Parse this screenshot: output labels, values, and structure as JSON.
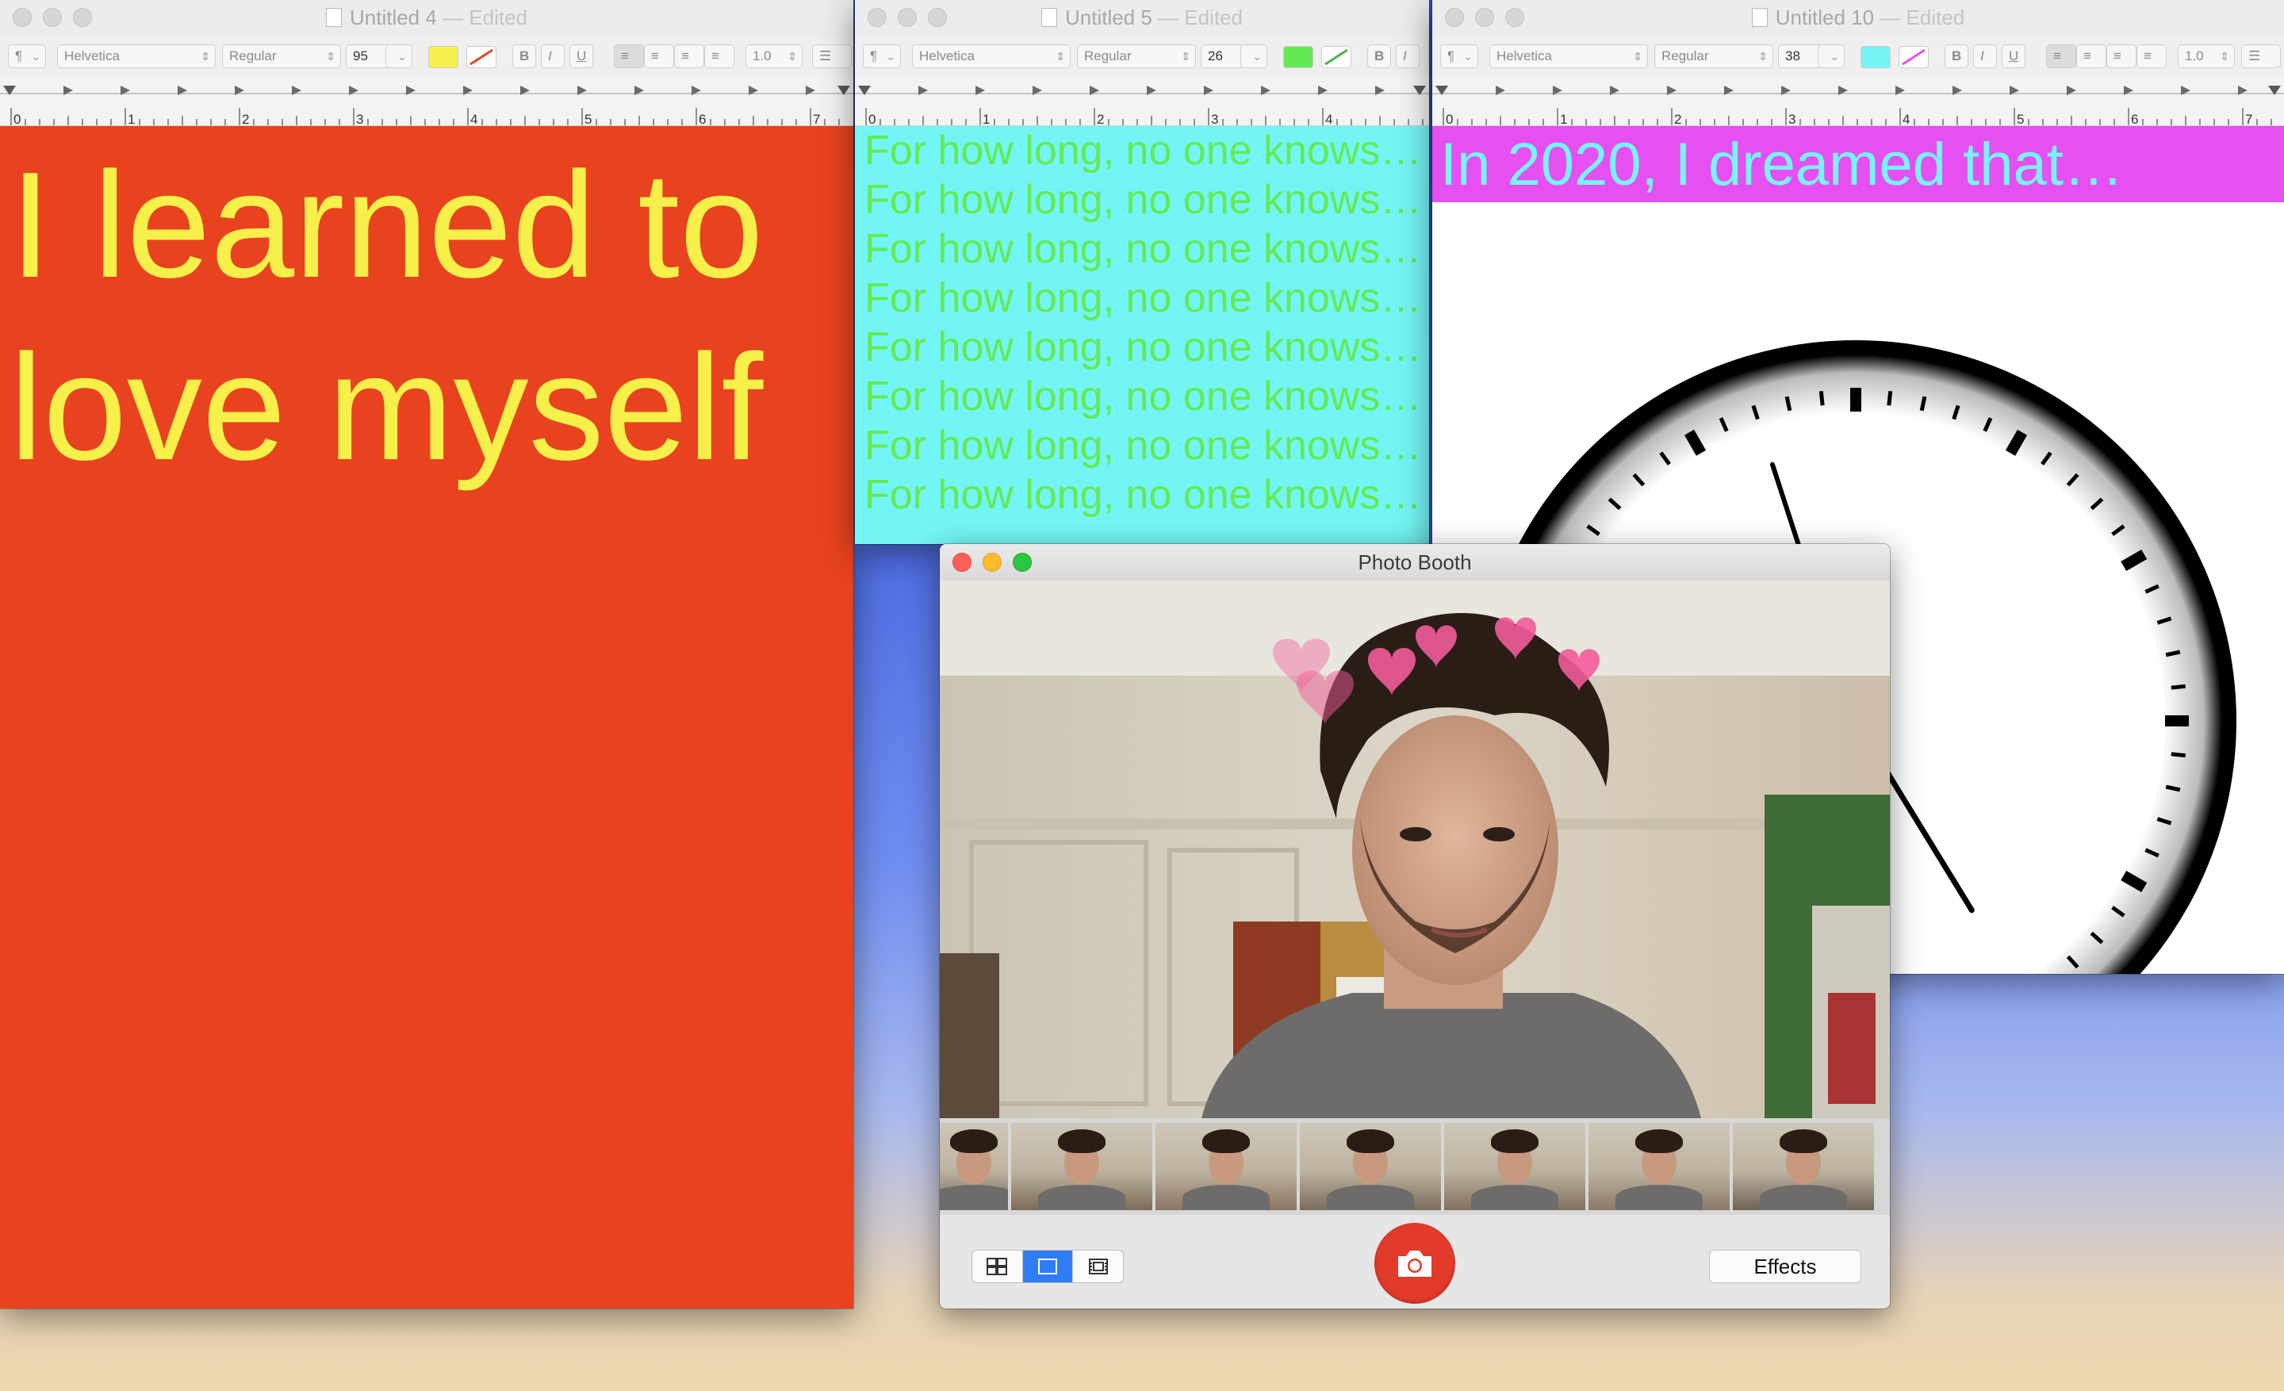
{
  "win1": {
    "title": "Untitled 4",
    "edited": "— Edited",
    "font_family": "Helvetica",
    "font_style": "Regular",
    "font_size": "95",
    "text_color": "#f8f04a",
    "bg_color": "#e8431e",
    "line_spacing": "1.0",
    "text": [
      "I learned to",
      "love myself"
    ]
  },
  "win2": {
    "title": "Untitled 5",
    "edited": "— Edited",
    "font_family": "Helvetica",
    "font_style": "Regular",
    "font_size": "26",
    "text_color": "#63ea52",
    "bg_color": "#74f5f5",
    "lines": [
      "For how long, no one knows…",
      "For how long, no one knows…",
      "For how long, no one knows…",
      "For how long, no one knows…",
      "For how long, no one knows…",
      "For how long, no one knows…",
      "For how long, no one knows…",
      "For how long, no one knows…"
    ]
  },
  "win3": {
    "title": "Untitled 10",
    "edited": "— Edited",
    "font_family": "Helvetica",
    "font_style": "Regular",
    "font_size": "38",
    "text_color": "#74f5f5",
    "bg_color": "#e64ff0",
    "line_spacing": "1.0",
    "text": "In 2020, I dreamed that…",
    "clock": {
      "hour": 4,
      "minute": 57
    }
  },
  "ruler_numbers": [
    "0",
    "1",
    "2",
    "3",
    "4",
    "5",
    "6",
    "7"
  ],
  "photobooth": {
    "title": "Photo Booth",
    "effects_label": "Effects",
    "view_modes": [
      "grid-view",
      "single-view",
      "strip-view"
    ],
    "selected_view": "single-view",
    "thumbnail_count": 7,
    "accent": "#e23a2b"
  }
}
